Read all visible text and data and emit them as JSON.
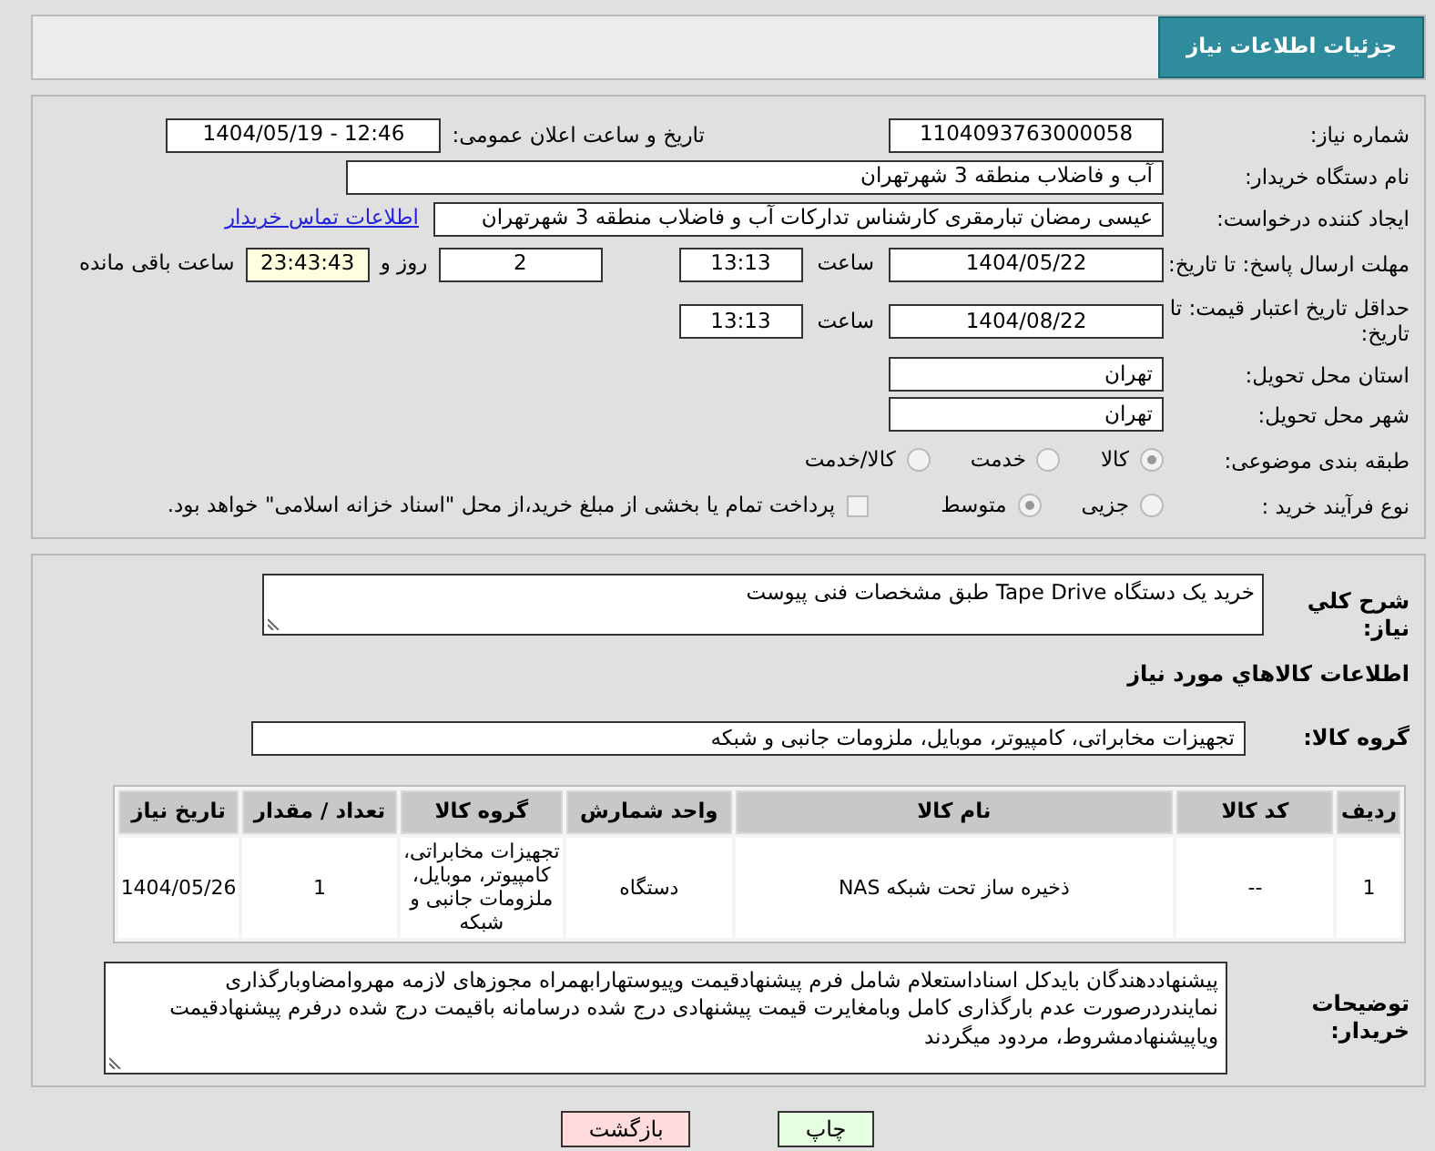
{
  "header": {
    "title": "جزئیات اطلاعات نیاز"
  },
  "need_number": {
    "label": "شماره نیاز:",
    "value": "1104093763000058"
  },
  "announce_datetime": {
    "label": "تاریخ و ساعت اعلان عمومی:",
    "value": "1404/05/19 - 12:46"
  },
  "buyer_org": {
    "label": "نام دستگاه خریدار:",
    "value": "آب و فاضلاب منطقه 3 شهرتهران"
  },
  "requester": {
    "label": "ایجاد کننده درخواست:",
    "value": "عیسی رمضان تبارمقری کارشناس تدارکات  آب و فاضلاب منطقه 3 شهرتهران",
    "contact_link": "اطلاعات تماس خریدار"
  },
  "response_deadline": {
    "label": "مهلت ارسال پاسخ: تا تاریخ:",
    "date": "1404/05/22",
    "time_label": "ساعت",
    "time": "13:13",
    "days": "2",
    "days_label": "روز و",
    "remaining": "23:43:43",
    "remaining_label": "ساعت باقی مانده"
  },
  "price_validity": {
    "label": "حداقل تاریخ اعتبار قیمت: تا تاریخ:",
    "date": "1404/08/22",
    "time_label": "ساعت",
    "time": "13:13"
  },
  "delivery_province": {
    "label": "استان محل تحویل:",
    "value": "تهران"
  },
  "delivery_city": {
    "label": "شهر محل تحویل:",
    "value": "تهران"
  },
  "subject_class": {
    "label": "طبقه بندی موضوعی:",
    "options": [
      {
        "label": "کالا",
        "selected": true
      },
      {
        "label": "خدمت",
        "selected": false
      },
      {
        "label": "کالا/خدمت",
        "selected": false
      }
    ]
  },
  "purchase_process": {
    "label": "نوع فرآیند خرید :",
    "options": [
      {
        "label": "جزیی",
        "selected": false
      },
      {
        "label": "متوسط",
        "selected": true
      }
    ],
    "payment_note": {
      "checked": false,
      "text": "پرداخت تمام یا بخشی از مبلغ خرید،از محل \"اسناد خزانه اسلامی\" خواهد بود."
    }
  },
  "description": {
    "label": "شرح کلي نياز:",
    "value": "خرید یک دستگاه Tape Drive طبق مشخصات فنی پیوست"
  },
  "goods_section": {
    "title": "اطلاعات كالاهاي مورد نياز"
  },
  "goods_group": {
    "label": "گروه کالا:",
    "value": "تجهیزات مخابراتی، کامپیوتر، موبایل، ملزومات جانبی و شبکه"
  },
  "table": {
    "columns": [
      "ردیف",
      "کد کالا",
      "نام کالا",
      "واحد شمارش",
      "گروه کالا",
      "تعداد / مقدار",
      "تاریخ نیاز"
    ],
    "rows": [
      [
        "1",
        "--",
        "ذخیره ساز تحت شبکه NAS",
        "دستگاه",
        "تجهیزات مخابراتی، کامپیوتر، موبایل، ملزومات جانبی و شبکه",
        "1",
        "1404/05/26"
      ]
    ]
  },
  "buyer_notes": {
    "label": "توضیحات خریدار:",
    "value": "پیشنهاددهندگان بایدکل اسناداستعلام شامل فرم پیشنهادقیمت وپیوستهارابهمراه مجوزهای لازمه مهروامضاوبارگذاری نمایندردرصورت عدم بارگذاری کامل وبامغایرت قیمت پیشنهادی درج شده درسامانه باقیمت درج شده درفرم پیشنهادقیمت وياپیشنهادمشروط، مردود میگردند"
  },
  "buttons": [
    {
      "label": "چاپ",
      "kind": "print"
    },
    {
      "label": "بازگشت",
      "kind": "back"
    }
  ]
}
